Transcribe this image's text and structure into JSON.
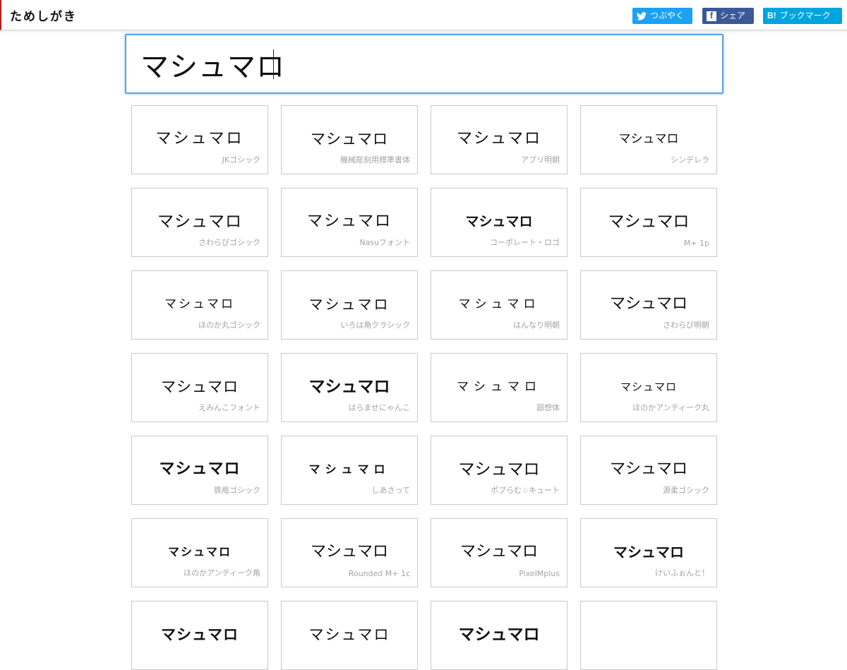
{
  "header": {
    "logo": "ためしがき",
    "share": [
      {
        "label": "つぶやく",
        "icon": "twitter-bird-icon",
        "color": "#1da1f2"
      },
      {
        "label": "シェア",
        "icon": "facebook-icon",
        "color": "#3b5998"
      },
      {
        "label": "ブックマーク",
        "icon": "hatena-bookmark-icon",
        "mark": "B!",
        "color": "#00a4de"
      }
    ]
  },
  "input": {
    "value": "マシュマロ"
  },
  "sample_text": "マシュマロ",
  "fonts": [
    "JKゴシック",
    "機械彫刻用標準書体",
    "アプリ明朝",
    "シンデレラ",
    "さわらびゴシック",
    "Nasuフォント",
    "コーポレート・ロゴ",
    "M+ 1p",
    "ほのか丸ゴシック",
    "いろは角クラシック",
    "はんなり明朝",
    "さわらび明朝",
    "えみんこフォント",
    "はらませにゃんこ",
    "廻想体",
    "ほのかアンティーク丸",
    "鉄瓶ゴシック",
    "しあさって",
    "ポプらむ☆キュート",
    "源柔ゴシック",
    "ほのかアンティーク角",
    "Rounded M+ 1c",
    "PixelMplus",
    "けいふぉんと！",
    "",
    "",
    "",
    ""
  ]
}
